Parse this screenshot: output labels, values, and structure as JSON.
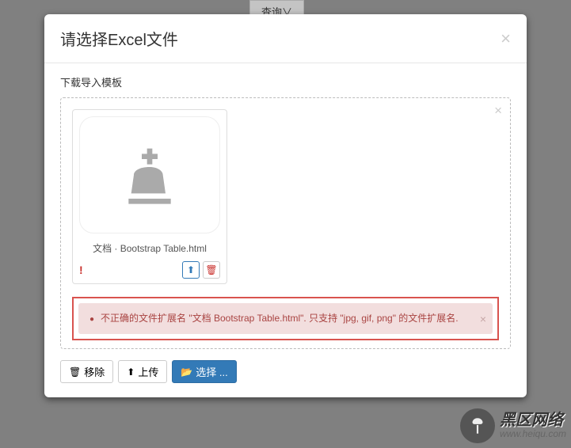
{
  "bgButton": {
    "label": "查询∨"
  },
  "modal": {
    "title": "请选择Excel文件",
    "templateLink": "下载导入模板"
  },
  "file": {
    "name": "文档 · Bootstrap Table.html"
  },
  "error": {
    "message": "不正确的文件扩展名 \"文档 Bootstrap Table.html\". 只支持 \"jpg, gif, png\" 的文件扩展名."
  },
  "actions": {
    "remove": "移除",
    "upload": "上传",
    "select": "选择 ..."
  },
  "watermark": {
    "main": "黑区网络",
    "sub": "www.heiqu.com"
  },
  "icons": {
    "close": "×",
    "trash": "🗑",
    "warn": "!",
    "folder": "📂",
    "uploadArrow": "⬆"
  }
}
